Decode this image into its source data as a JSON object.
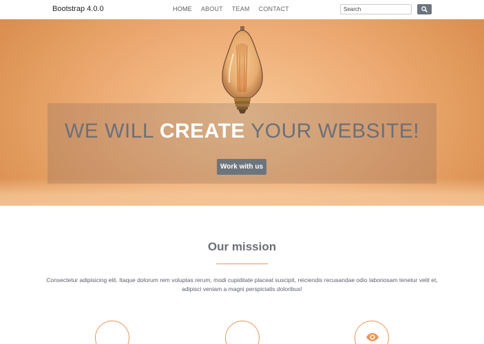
{
  "navbar": {
    "brand": "Bootstrap 4.0.0",
    "links": [
      {
        "label": "HOME"
      },
      {
        "label": "ABOUT"
      },
      {
        "label": "TEAM"
      },
      {
        "label": "CONTACT"
      }
    ],
    "search": {
      "placeholder": "Search",
      "value": ""
    },
    "search_icon": "search-icon"
  },
  "hero": {
    "title_part1": "WE WILL ",
    "title_strong": "CREATE",
    "title_part2": " YOUR WEBSITE!",
    "button_label": "Work with us",
    "accent_color": "#e8965a"
  },
  "mission": {
    "title": "Our mission",
    "text": "Consectetur adipisicing elit. Itaque dolorum rem voluptas rerum, modi cupiditate placeat suscipit, reiciendis recusandae odio laboriosam tenetur velit et, adipisci veniam a magni perspiciatis doloribus!",
    "feature_icons": [
      "circle-icon",
      "circle-icon",
      "eye-icon"
    ]
  }
}
